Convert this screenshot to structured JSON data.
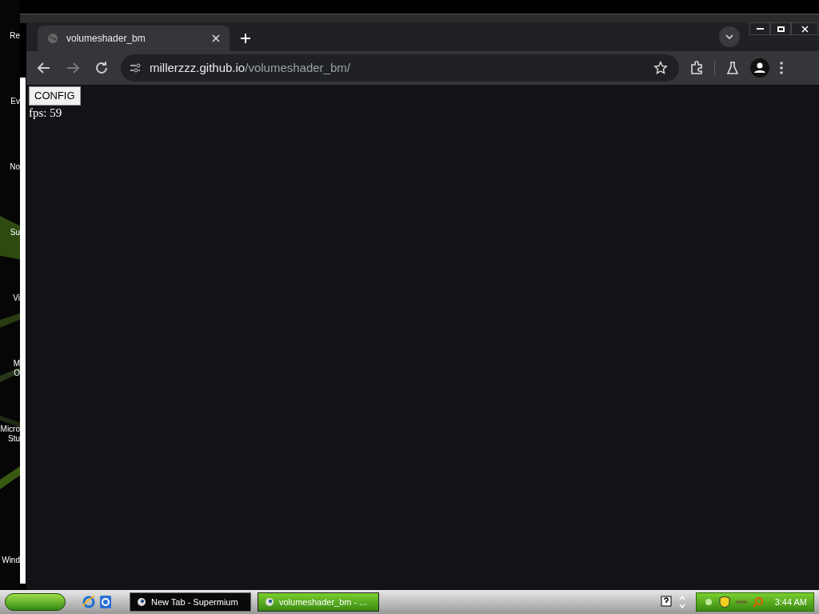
{
  "desktop": {
    "icons": [
      {
        "lines": [
          "Re"
        ]
      },
      {
        "lines": [
          "Ev"
        ]
      },
      {
        "lines": [
          "No"
        ]
      },
      {
        "lines": [
          "Su"
        ]
      },
      {
        "lines": [
          "Vi"
        ]
      },
      {
        "lines": [
          "M",
          "O"
        ]
      },
      {
        "lines": [
          "Micro",
          "Stu"
        ]
      },
      {
        "lines": [
          "Wind"
        ]
      }
    ]
  },
  "browser": {
    "tabs": [
      {
        "title": "volumeshader_bm",
        "selected": true
      }
    ],
    "address": {
      "host": "millerzzz.github.io",
      "path": "/volumeshader_bm/"
    },
    "page": {
      "button": "CONFIG",
      "fps": "fps: 59"
    }
  },
  "taskbar": {
    "tasks": [
      {
        "label": "New Tab - Supermium",
        "selected": false
      },
      {
        "label": "volumeshader_bm - ...",
        "selected": true
      }
    ],
    "clock": "3:44 AM"
  }
}
